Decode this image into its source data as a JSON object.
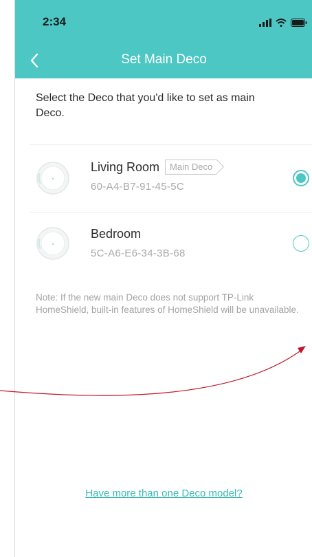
{
  "status_bar": {
    "time": "2:34",
    "icons": [
      "cellular-signal-icon",
      "wifi-icon",
      "battery-icon"
    ]
  },
  "header": {
    "title": "Set Main Deco",
    "back_icon": "chevron-left-icon"
  },
  "instruction": "Select the Deco that you'd like to set as main Deco.",
  "decos": [
    {
      "name": "Living Room",
      "tag": "Main Deco",
      "mac": "60-A4-B7-91-45-5C",
      "selected": true
    },
    {
      "name": "Bedroom",
      "tag": "",
      "mac": "5C-A6-E6-34-3B-68",
      "selected": false
    }
  ],
  "note": "Note: If the new main Deco does not support TP-Link HomeShield, built-in features of HomeShield will be unavailable.",
  "more_link": "Have more than one Deco model?",
  "colors": {
    "accent": "#4cc7c4",
    "link": "#36b9b6",
    "annotation_arrow": "#c0182a"
  }
}
